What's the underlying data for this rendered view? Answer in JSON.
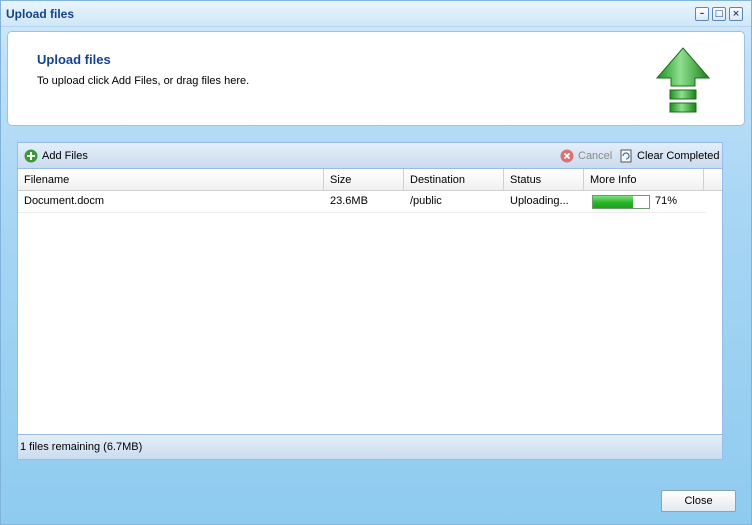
{
  "window": {
    "title": "Upload files",
    "controls": {
      "minimize": "–",
      "maximize": "□",
      "close": "×"
    }
  },
  "header": {
    "title": "Upload files",
    "subtitle": "To upload click Add Files, or drag files here.",
    "icon": "upload-arrow-icon"
  },
  "toolbar": {
    "add_files_label": "Add Files",
    "cancel_label": "Cancel",
    "clear_completed_label": "Clear Completed"
  },
  "grid": {
    "columns": [
      "Filename",
      "Size",
      "Destination",
      "Status",
      "More Info"
    ],
    "rows": [
      {
        "filename": "Document.docm",
        "size": "23.6MB",
        "destination": "/public",
        "status": "Uploading...",
        "progress_label": "71%",
        "progress": 0.71
      }
    ]
  },
  "footer": {
    "remaining": "1 files remaining (6.7MB)"
  },
  "actions": {
    "close_label": "Close"
  },
  "colors": {
    "title": "#15428b",
    "progress": "#27b527",
    "cancel_disabled": "#8a8a8a",
    "cancel_icon": "#d94c4c"
  }
}
